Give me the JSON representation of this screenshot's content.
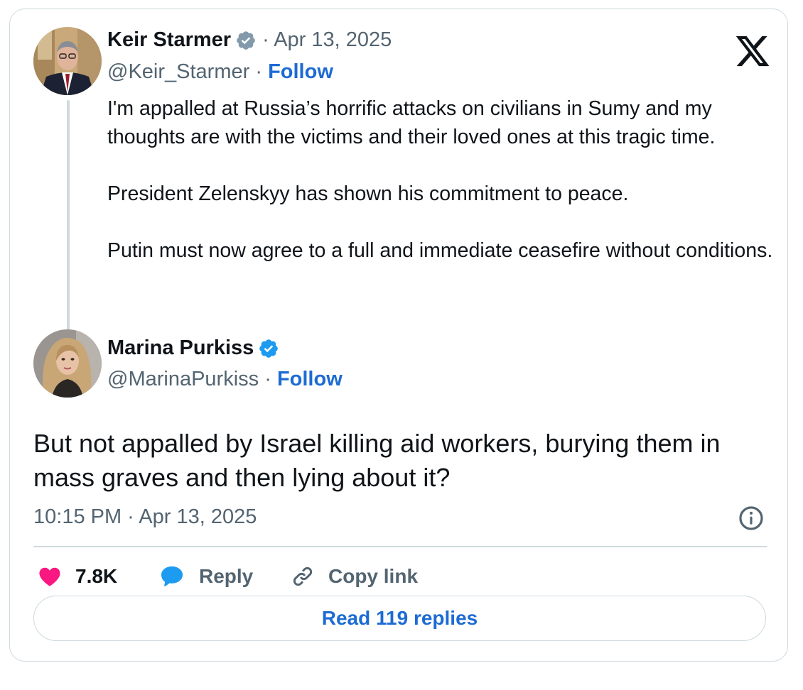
{
  "quoted_tweet": {
    "author_name": "Keir Starmer",
    "date": "· Apr 13, 2025",
    "handle": "@Keir_Starmer",
    "follow_label": "Follow",
    "paragraphs": [
      "I'm appalled at Russia’s horrific attacks on civilians in Sumy and my thoughts are with the victims and their loved ones at this tragic time.",
      "President Zelenskyy has shown his commitment to peace.",
      "Putin must now agree to a full and immediate ceasefire without conditions."
    ]
  },
  "main_tweet": {
    "author_name": "Marina Purkiss",
    "handle": "@MarinaPurkiss",
    "follow_label": "Follow",
    "text": "But not appalled by Israel killing aid workers, burying them in mass graves and then lying about it?",
    "timestamp": "10:15 PM · Apr 13, 2025"
  },
  "actions": {
    "like_count": "7.8K",
    "reply_label": "Reply",
    "copy_link_label": "Copy link"
  },
  "read_replies_label": "Read 119 replies",
  "icons": {
    "verified": "verified-badge-icon",
    "logo": "x-logo-icon",
    "info": "info-icon",
    "like": "heart-icon",
    "reply": "speech-bubble-icon",
    "link": "link-icon"
  },
  "colors": {
    "link_blue": "#1d6bd3",
    "secondary_text": "#536471",
    "heart": "#f91880",
    "reply_bubble": "#1d9bf0",
    "verified_gray": "#829aab",
    "verified_blue": "#1d9bf0",
    "border": "#cfd9de"
  }
}
